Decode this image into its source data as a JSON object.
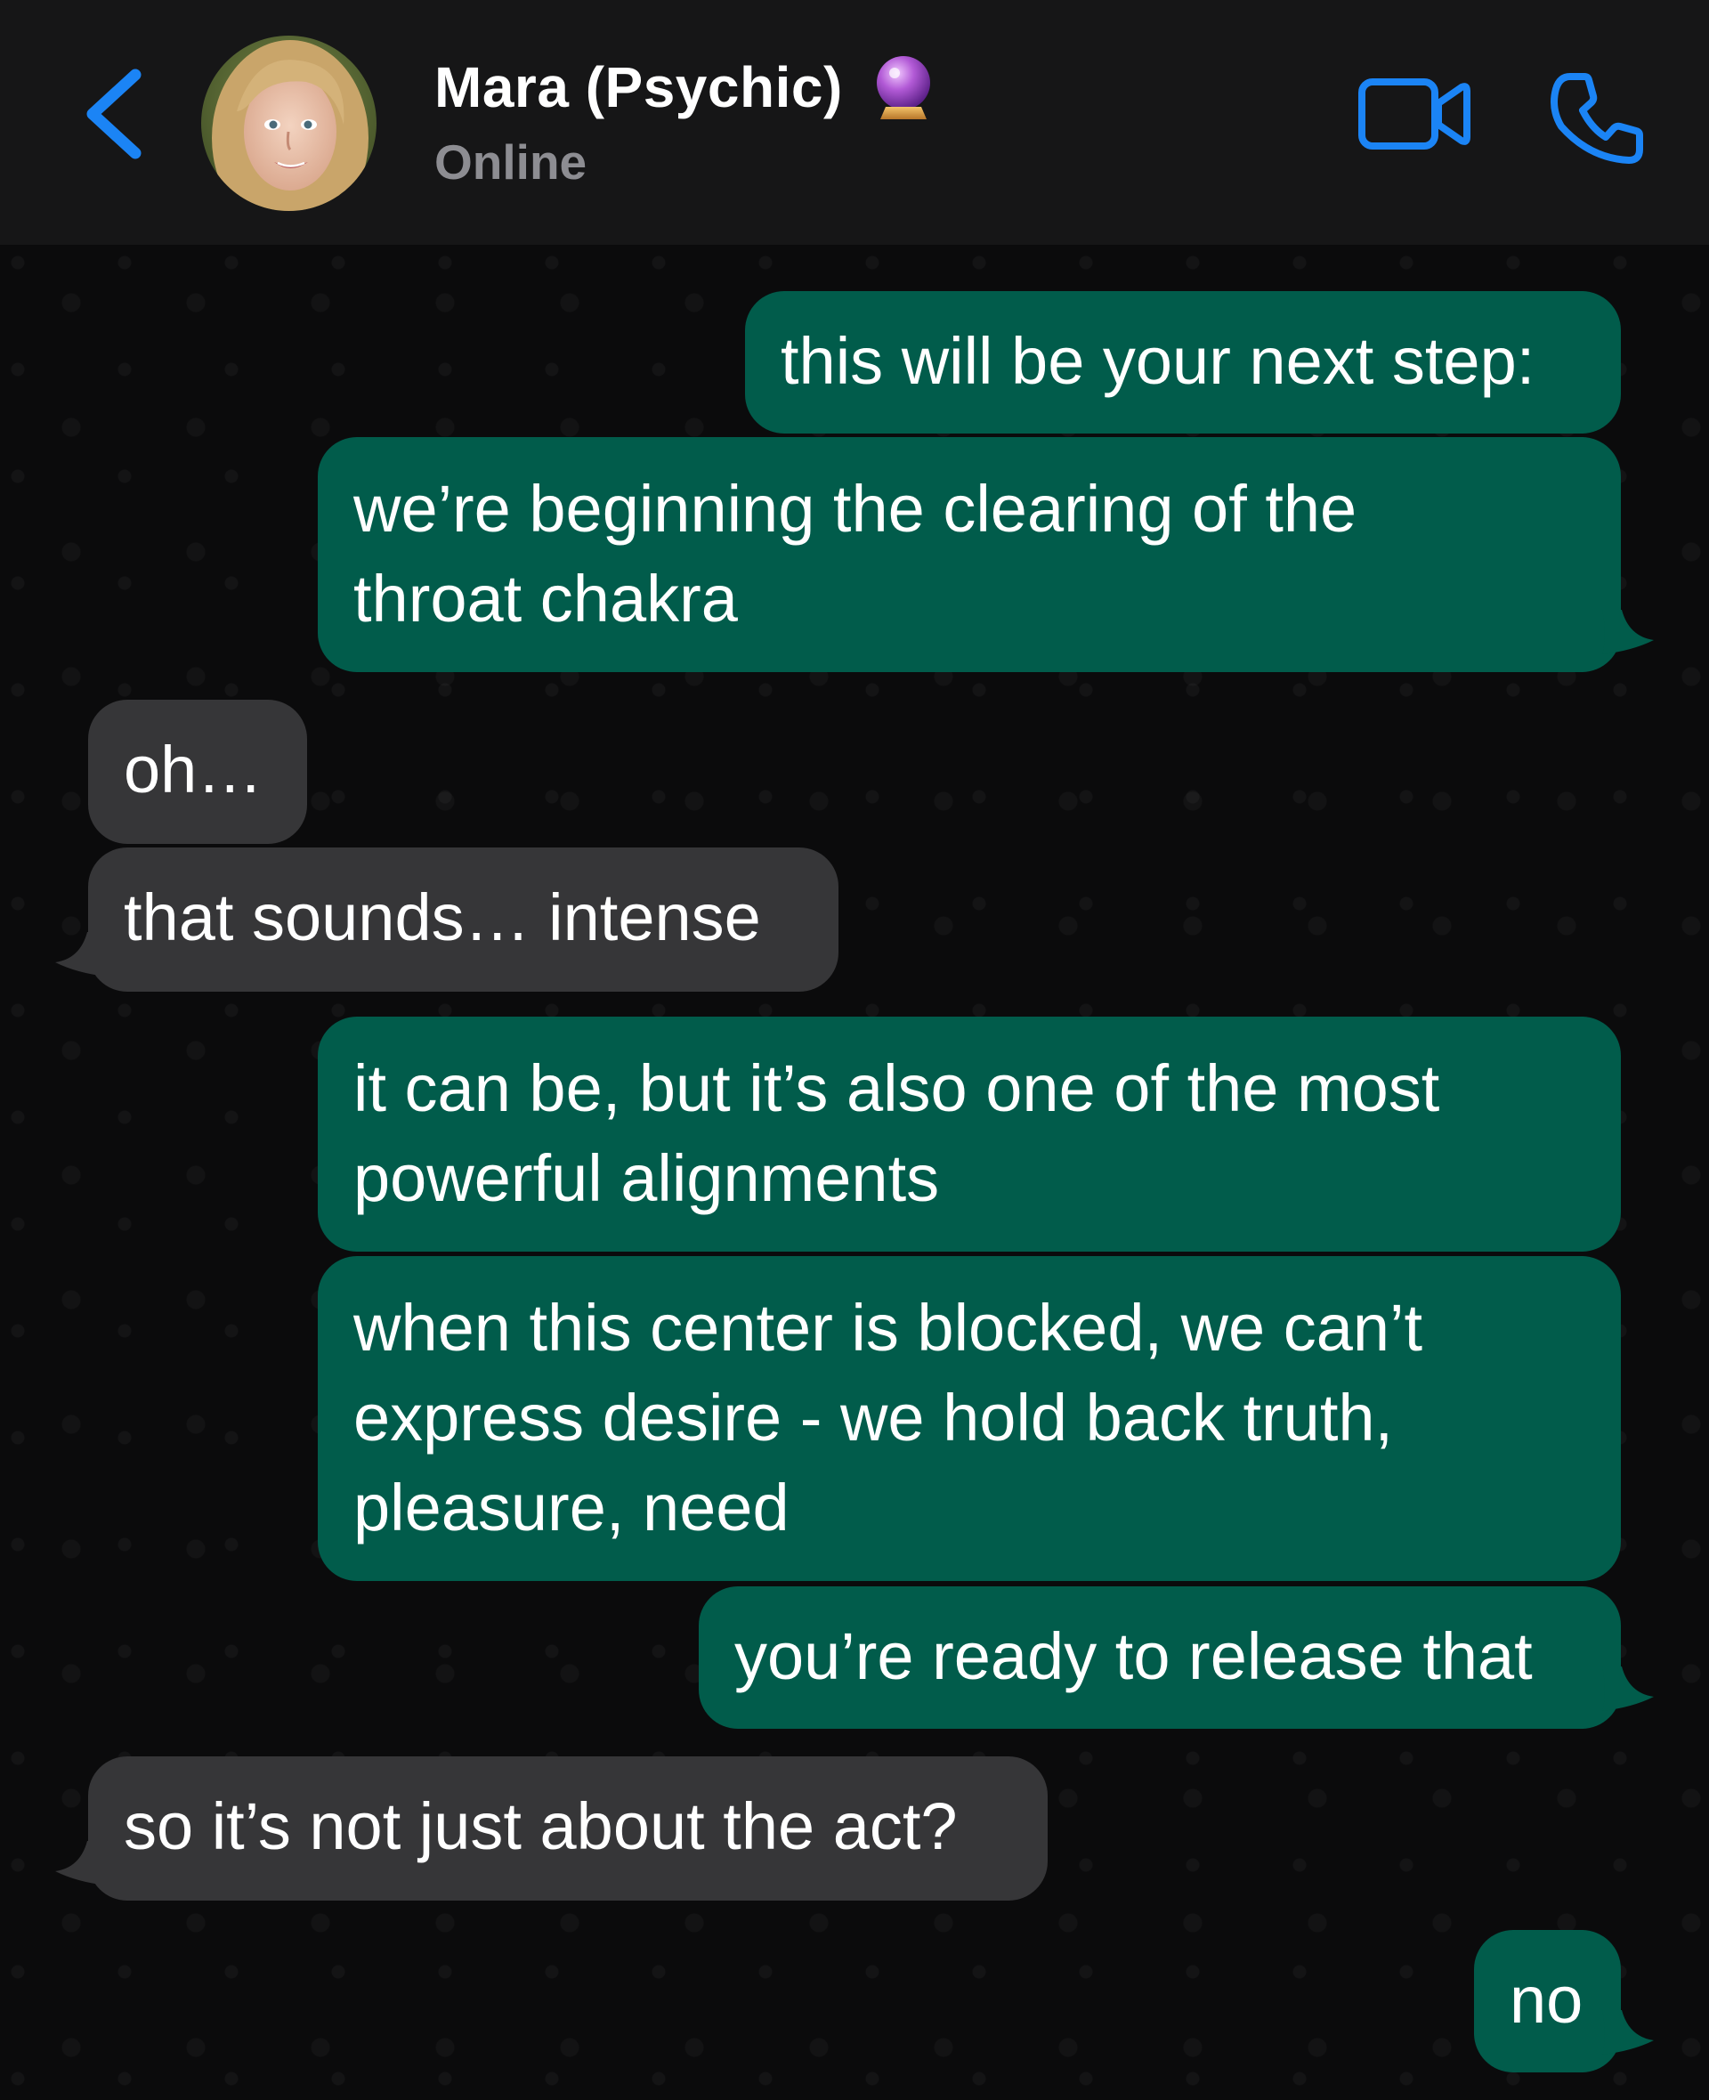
{
  "header": {
    "contact_name": "Mara (Psychic)",
    "status": "Online",
    "icons": {
      "back": "chevron-left-icon",
      "name_emoji": "crystal-ball-icon",
      "video": "video-camera-icon",
      "call": "phone-icon"
    },
    "accent_color": "#1b84f5"
  },
  "colors": {
    "outgoing_bubble": "#015c4b",
    "incoming_bubble": "#363638",
    "header_background": "#161617",
    "chat_background": "#0b0b0c"
  },
  "messages": [
    {
      "direction": "outgoing",
      "lines": [
        "this will be your next step:"
      ]
    },
    {
      "direction": "outgoing",
      "lines": [
        "we’re beginning the clearing of the",
        "throat chakra"
      ]
    },
    {
      "direction": "incoming",
      "lines": [
        "oh…"
      ]
    },
    {
      "direction": "incoming",
      "lines": [
        "that sounds… intense"
      ]
    },
    {
      "direction": "outgoing",
      "lines": [
        "it can be, but it’s also one of the most",
        "powerful alignments"
      ]
    },
    {
      "direction": "outgoing",
      "lines": [
        "when this center is blocked, we can’t",
        "express desire - we hold back truth,",
        "pleasure, need"
      ]
    },
    {
      "direction": "outgoing",
      "lines": [
        "you’re ready to release that"
      ]
    },
    {
      "direction": "incoming",
      "lines": [
        "so it’s not just about the act?"
      ]
    },
    {
      "direction": "outgoing",
      "lines": [
        "no"
      ]
    }
  ]
}
